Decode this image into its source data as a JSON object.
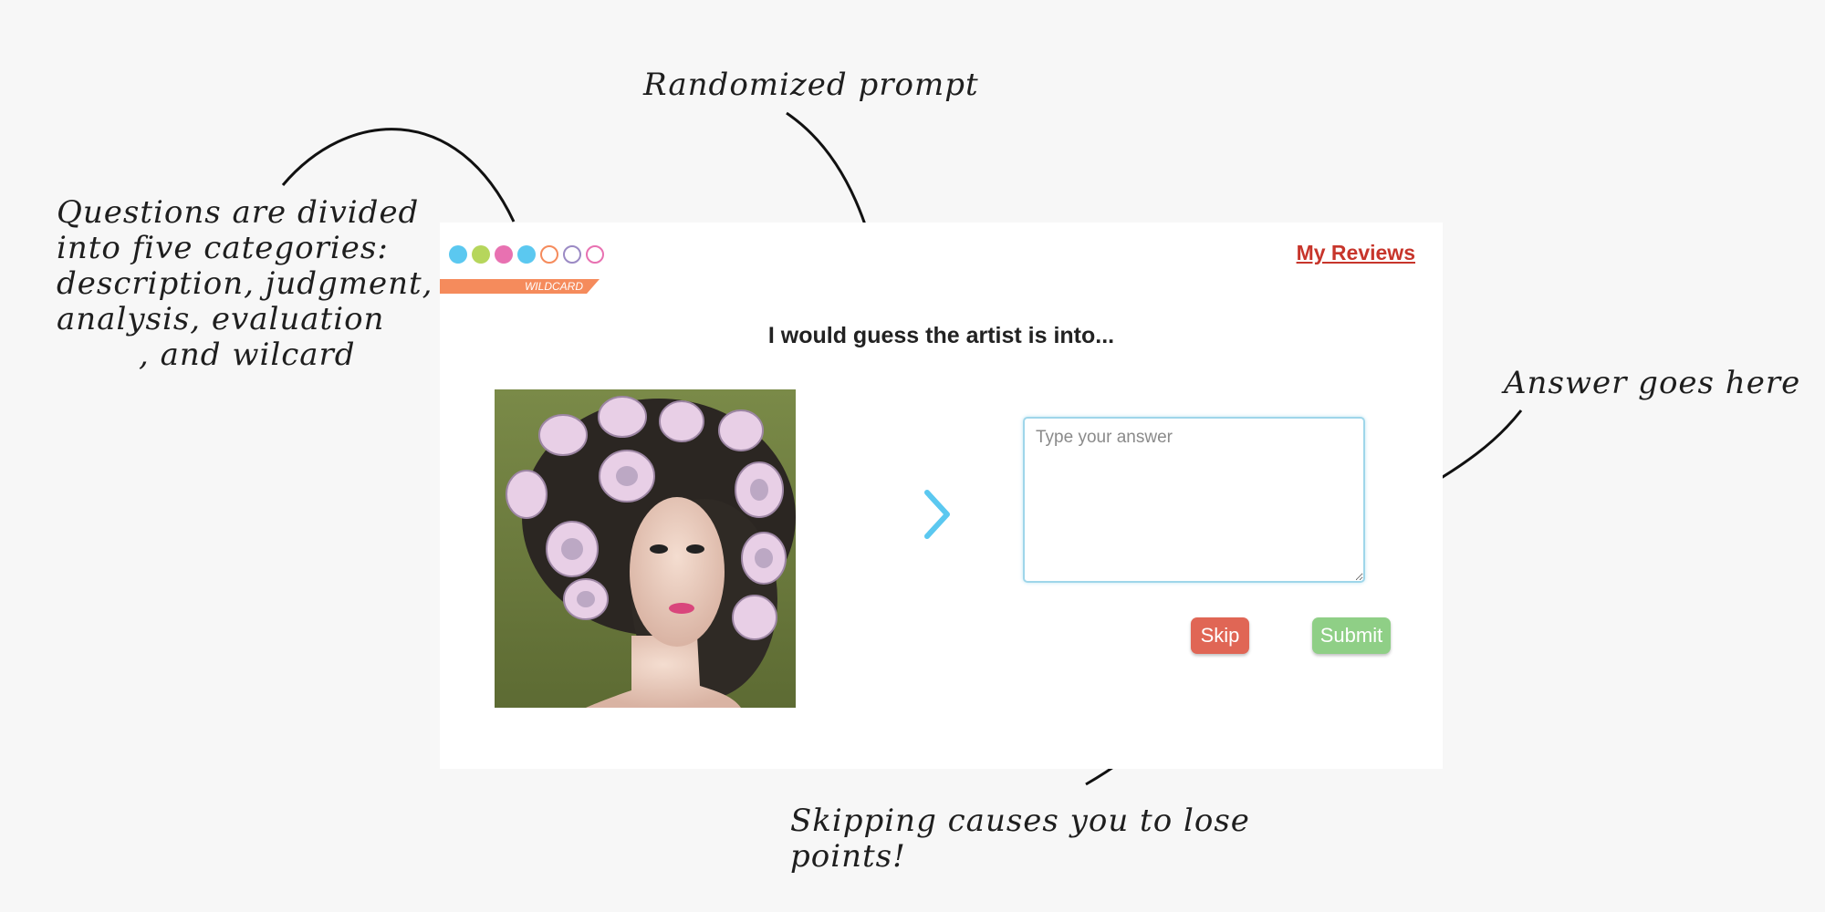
{
  "annotations": {
    "categories_lines": [
      "Questions are divided",
      "into five categories:",
      "description, judgment,",
      "analysis, evaluation",
      ", and wilcard"
    ],
    "prompt_note": "Randomized prompt",
    "answer_note": "Answer goes here",
    "skip_lines": [
      "Skipping causes you to lose",
      "points!"
    ]
  },
  "app": {
    "category_dots": [
      {
        "color": "#5bc8f0",
        "filled": true
      },
      {
        "color": "#b6d65c",
        "filled": true
      },
      {
        "color": "#e871b1",
        "filled": true
      },
      {
        "color": "#5bc8f0",
        "filled": true
      },
      {
        "color": "#f58b5c",
        "filled": false
      },
      {
        "color": "#9b8ac4",
        "filled": false
      },
      {
        "color": "#e871b1",
        "filled": false
      }
    ],
    "category_tag": "WILDCARD",
    "reviews_link": "My Reviews",
    "prompt": "I would guess the artist is into...",
    "answer_placeholder": "Type your answer",
    "skip_label": "Skip",
    "submit_label": "Submit"
  },
  "colors": {
    "accent_blue": "#5bc8f0",
    "skip": "#e06655",
    "submit": "#8fcf86",
    "link": "#c7352b",
    "tag": "#f58b5c"
  }
}
